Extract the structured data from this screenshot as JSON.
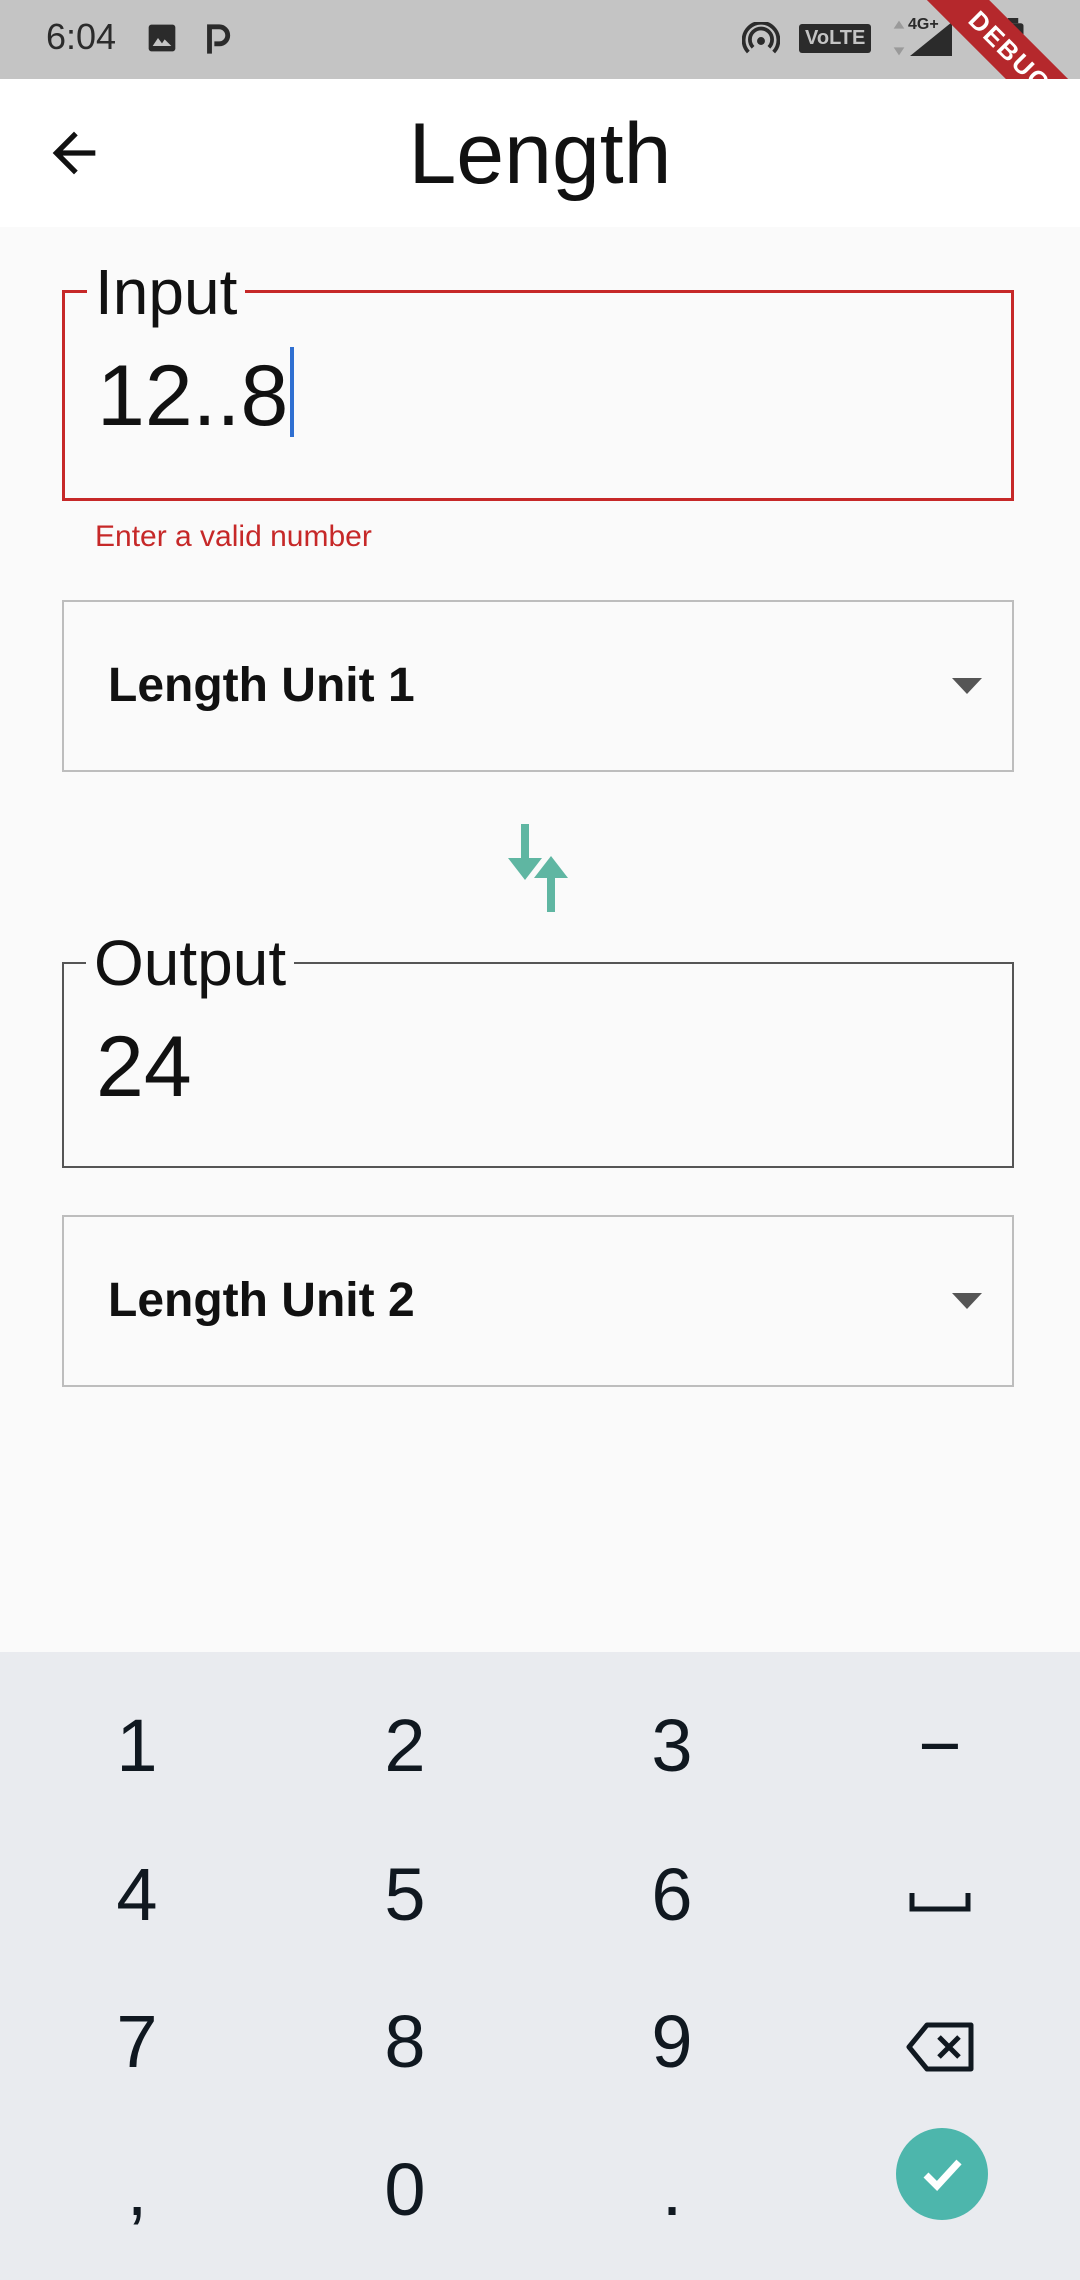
{
  "status_bar": {
    "time": "6:04",
    "left_icons": [
      "image-icon",
      "p-icon"
    ],
    "right_icons": [
      "hotspot-icon",
      "volte-icon",
      "4g-icon",
      "signal-icon",
      "battery-icon"
    ],
    "volte_text": "VoLTE",
    "net_text": "4G+",
    "debug_label": "DEBUG"
  },
  "app_bar": {
    "title": "Length"
  },
  "input_field": {
    "label": "Input",
    "value": "12..8",
    "error": "Enter a valid number"
  },
  "unit1": {
    "label": "Length Unit 1"
  },
  "output_field": {
    "label": "Output",
    "value": "24"
  },
  "unit2": {
    "label": "Length Unit 2"
  },
  "keyboard": {
    "rows": [
      [
        "1",
        "2",
        "3",
        "−"
      ],
      [
        "4",
        "5",
        "6",
        "space"
      ],
      [
        "7",
        "8",
        "9",
        "backspace"
      ],
      [
        ",",
        "0",
        ".",
        "done"
      ]
    ],
    "accent": "#4db6ac"
  },
  "colors": {
    "error": "#c62828",
    "accent": "#5fb6a2"
  }
}
